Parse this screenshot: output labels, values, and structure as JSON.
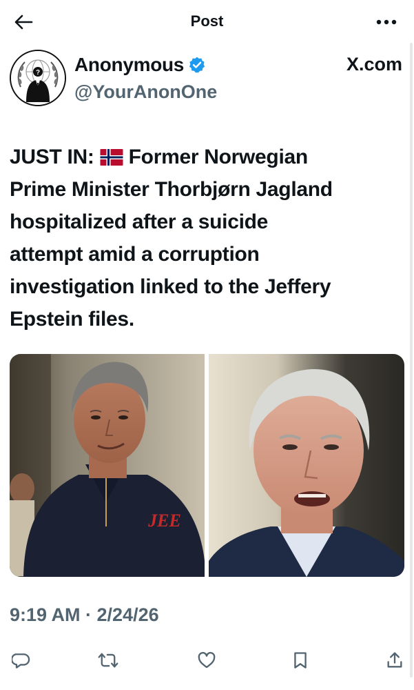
{
  "header": {
    "title": "Post",
    "back_icon": "arrow-left-icon",
    "more_icon": "more-horizontal-icon"
  },
  "author": {
    "name": "Anonymous",
    "verified": true,
    "verified_color": "#1d9bf0",
    "handle": "@YourAnonOne",
    "avatar_icon": "anonymous-mask-logo",
    "source": "X.com"
  },
  "post": {
    "text_prefix": "JUST IN: ",
    "flag": "Norway flag emoji",
    "text_body": "Former Norwegian\nPrime Minister Thorbjørn Jagland\nhospitalized after a suicide\nattempt amid a corruption\ninvestigation linked to the Jeffery\nEpstein files.",
    "media": [
      {
        "description": "man in dark zip sweater with red monogram"
      },
      {
        "description": "white-haired older man in suit"
      }
    ],
    "timestamp": "9:19 AM · 2/24/26"
  },
  "actions": [
    {
      "icon": "reply-icon"
    },
    {
      "icon": "repost-icon"
    },
    {
      "icon": "like-icon"
    },
    {
      "icon": "bookmark-icon"
    },
    {
      "icon": "share-icon"
    }
  ],
  "colors": {
    "text": "#0f1419",
    "secondary": "#536471",
    "icon": "#536471",
    "flag_red": "#ba0c2f",
    "flag_blue": "#00205b"
  }
}
